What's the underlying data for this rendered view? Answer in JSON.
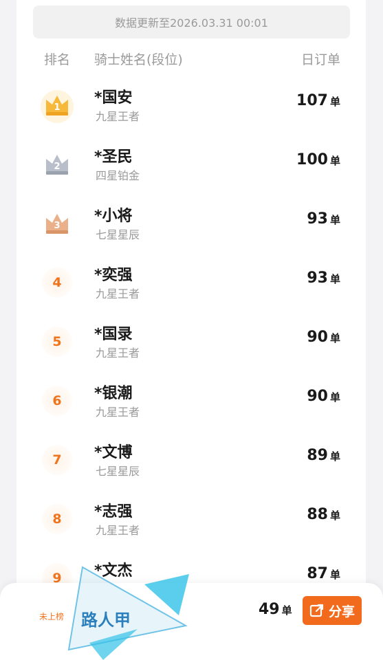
{
  "update_notice": "数据更新至2026.03.31 00:01",
  "columns": {
    "rank": "排名",
    "name": "骑士姓名(段位)",
    "orders": "日订单"
  },
  "unit": "单",
  "rows": [
    {
      "rank": "1",
      "name": "*国安",
      "level": "九星王者",
      "orders": "107",
      "badge": "gold-crown"
    },
    {
      "rank": "2",
      "name": "*圣民",
      "level": "四星铂金",
      "orders": "100",
      "badge": "silver-crown"
    },
    {
      "rank": "3",
      "name": "*小将",
      "level": "七星星辰",
      "orders": "93",
      "badge": "bronze-crown"
    },
    {
      "rank": "4",
      "name": "*奕强",
      "level": "九星王者",
      "orders": "93"
    },
    {
      "rank": "5",
      "name": "*国录",
      "level": "九星王者",
      "orders": "90"
    },
    {
      "rank": "6",
      "name": "*银潮",
      "level": "九星王者",
      "orders": "90"
    },
    {
      "rank": "7",
      "name": "*文博",
      "level": "七星星辰",
      "orders": "89"
    },
    {
      "rank": "8",
      "name": "*志强",
      "level": "九星王者",
      "orders": "88"
    },
    {
      "rank": "9",
      "name": "*文杰",
      "level": "",
      "orders": "87"
    }
  ],
  "me": {
    "status": "未上榜",
    "name": "路人甲",
    "orders": "49",
    "share_label": "分享"
  },
  "colors": {
    "accent": "#f26a1b",
    "gold": "#f6b93b",
    "silver": "#a9b1bd",
    "bronze": "#e6a27a"
  }
}
